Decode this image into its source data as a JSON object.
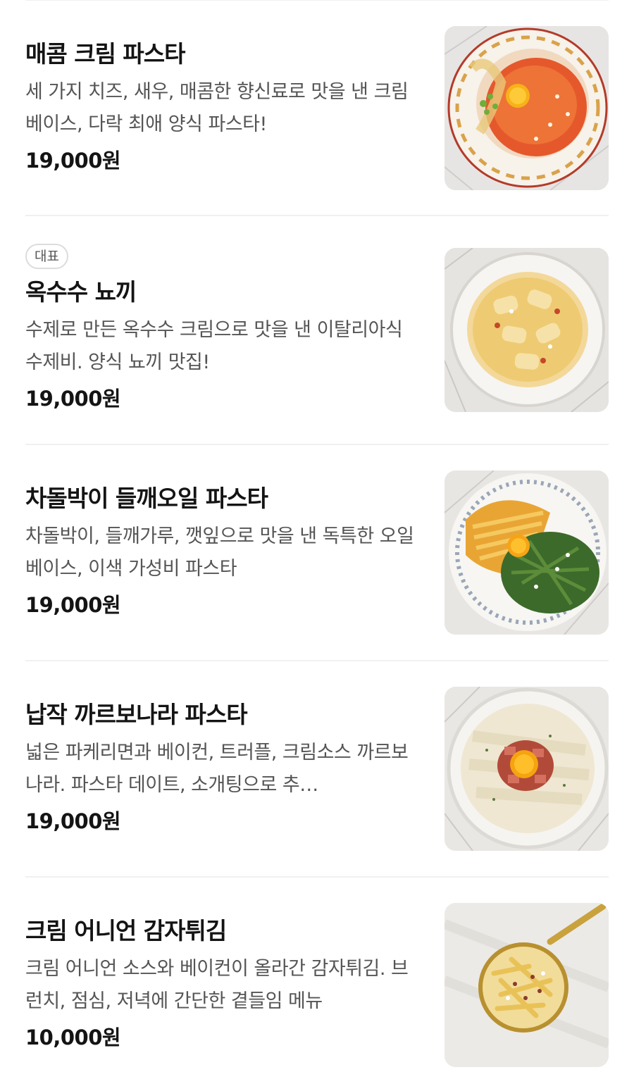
{
  "menu": {
    "items": [
      {
        "badge": "",
        "name": "매콤 크림 파스타",
        "description": "세 가지 치즈, 새우, 매콤한 향신료로 맛을 낸 크림 베이스, 다락 최애 양식 파스타!",
        "price": "19,000원",
        "image_icon": "spicy-cream-pasta-photo"
      },
      {
        "badge": "대표",
        "name": "옥수수 뇨끼",
        "description": "수제로 만든 옥수수 크림으로 맛을 낸 이탈리아식 수제비. 양식 뇨끼 맛집!",
        "price": "19,000원",
        "image_icon": "corn-gnocchi-photo"
      },
      {
        "badge": "",
        "name": "차돌박이 들깨오일 파스타",
        "description": "차돌박이, 들깨가루, 깻잎으로 맛을 낸 독특한 오일 베이스, 이색 가성비 파스타",
        "price": "19,000원",
        "image_icon": "perilla-oil-pasta-photo"
      },
      {
        "badge": "",
        "name": "납작 까르보나라 파스타",
        "description": "넓은 파케리면과 베이컨, 트러플, 크림소스 까르보나라. 파스타 데이트, 소개팅으로 추…",
        "price": "19,000원",
        "image_icon": "flat-carbonara-photo"
      },
      {
        "badge": "",
        "name": "크림 어니언 감자튀김",
        "description": "크림 어니언 소스와 베이컨이 올라간 감자튀김. 브런치, 점심, 저녁에 간단한 곁들임 메뉴",
        "price": "10,000원",
        "image_icon": "cream-onion-fries-photo"
      }
    ]
  }
}
